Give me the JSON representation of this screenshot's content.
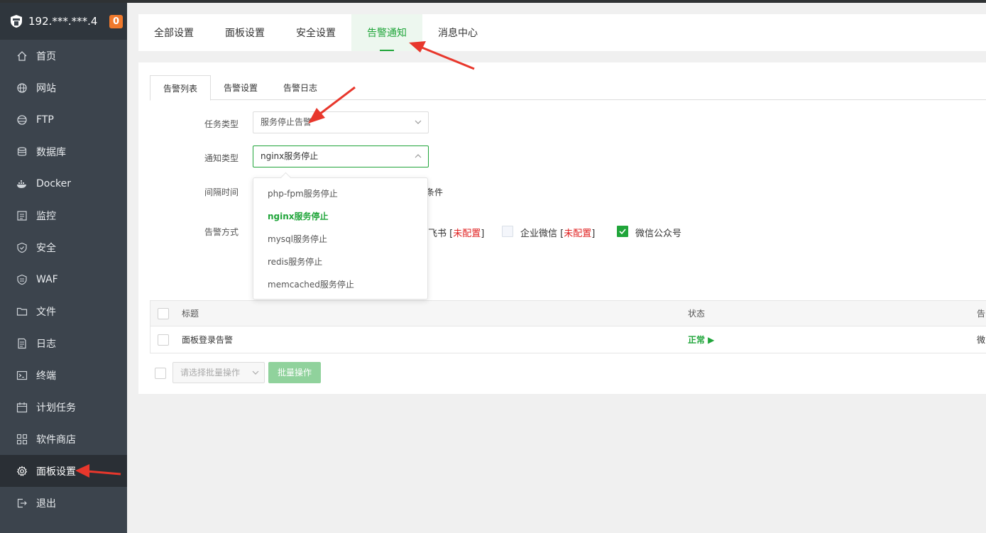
{
  "colors": {
    "accent": "#20a53a",
    "sidebar": "#3c444d",
    "badge": "#f0792c",
    "danger": "#e02020",
    "arrow": "#e8372c"
  },
  "sidebar": {
    "server_ip": "192.***.***.4",
    "badge_count": "0",
    "items": [
      {
        "label": "首页",
        "icon": "home-icon"
      },
      {
        "label": "网站",
        "icon": "globe-icon"
      },
      {
        "label": "FTP",
        "icon": "ftp-globe-icon"
      },
      {
        "label": "数据库",
        "icon": "database-icon"
      },
      {
        "label": "Docker",
        "icon": "docker-icon"
      },
      {
        "label": "监控",
        "icon": "monitor-icon"
      },
      {
        "label": "安全",
        "icon": "shield-icon"
      },
      {
        "label": "WAF",
        "icon": "waf-shield-icon"
      },
      {
        "label": "文件",
        "icon": "folder-icon"
      },
      {
        "label": "日志",
        "icon": "log-icon"
      },
      {
        "label": "终端",
        "icon": "terminal-icon"
      },
      {
        "label": "计划任务",
        "icon": "calendar-icon"
      },
      {
        "label": "软件商店",
        "icon": "apps-icon"
      },
      {
        "label": "面板设置",
        "icon": "gear-icon",
        "active": true
      },
      {
        "label": "退出",
        "icon": "logout-icon"
      }
    ]
  },
  "top_tabs": {
    "items": [
      "全部设置",
      "面板设置",
      "安全设置",
      "告警通知",
      "消息中心"
    ],
    "active": "告警通知"
  },
  "sub_tabs": {
    "items": [
      "告警列表",
      "告警设置",
      "告警日志"
    ],
    "active": "告警列表"
  },
  "form": {
    "task_type_label": "任务类型",
    "task_type_value": "服务停止告警",
    "notify_type_label": "通知类型",
    "notify_type_value": "nginx服务停止",
    "interval_label": "间隔时间",
    "interval_partial_text": "条件",
    "method_label": "告警方式",
    "methods": [
      {
        "label": "飞书",
        "note": "未配置",
        "checked": false
      },
      {
        "label": "企业微信",
        "note": "未配置",
        "checked": false
      },
      {
        "label": "微信公众号",
        "note": "",
        "checked": true
      }
    ]
  },
  "dropdown": {
    "options": [
      "php-fpm服务停止",
      "nginx服务停止",
      "mysql服务停止",
      "redis服务停止",
      "memcached服务停止"
    ],
    "selected": "nginx服务停止"
  },
  "table": {
    "headers": {
      "title": "标题",
      "status": "状态",
      "method": "告"
    },
    "rows": [
      {
        "title": "面板登录告警",
        "status": "正常 ▶",
        "method": "微"
      }
    ]
  },
  "batch": {
    "select_placeholder": "请选择批量操作",
    "button_label": "批量操作"
  }
}
